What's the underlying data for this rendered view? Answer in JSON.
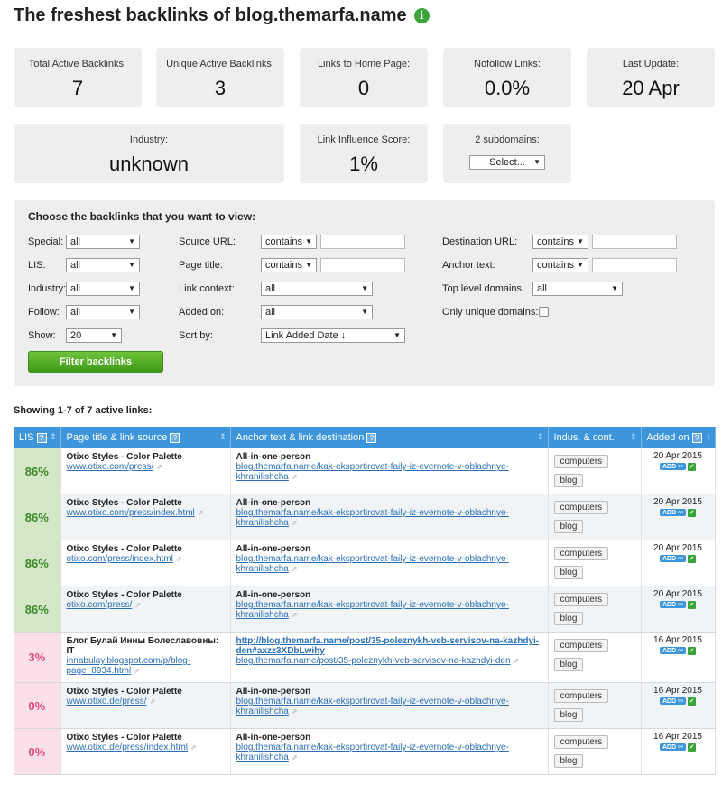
{
  "page_title": "The freshest backlinks of blog.themarfa.name",
  "stats": {
    "total_label": "Total Active Backlinks:",
    "total_value": "7",
    "unique_label": "Unique Active Backlinks:",
    "unique_value": "3",
    "home_label": "Links to Home Page:",
    "home_value": "0",
    "nofollow_label": "Nofollow Links:",
    "nofollow_value": "0.0%",
    "update_label": "Last Update:",
    "update_value": "20 Apr",
    "industry_label": "Industry:",
    "industry_value": "unknown",
    "lis_label": "Link Influence Score:",
    "lis_value": "1%",
    "subdomains_label": "2 subdomains:",
    "subdomains_select": "Select..."
  },
  "filter": {
    "heading": "Choose the backlinks that you want to view:",
    "special_label": "Special:",
    "special_value": "all",
    "lis_label": "LIS:",
    "lis_value": "all",
    "industry_label": "Industry:",
    "industry_value": "all",
    "follow_label": "Follow:",
    "follow_value": "all",
    "show_label": "Show:",
    "show_value": "20",
    "source_url_label": "Source URL:",
    "source_url_op": "contains",
    "page_title_label": "Page title:",
    "page_title_op": "contains",
    "link_context_label": "Link context:",
    "link_context_value": "all",
    "added_on_label": "Added on:",
    "added_on_value": "all",
    "sort_by_label": "Sort by:",
    "sort_by_value": "Link Added Date ↓",
    "dest_url_label": "Destination URL:",
    "dest_url_op": "contains",
    "anchor_text_label": "Anchor text:",
    "anchor_text_op": "contains",
    "tld_label": "Top level domains:",
    "tld_value": "all",
    "unique_domains_label": "Only unique domains:",
    "button": "Filter backlinks"
  },
  "showing": "Showing 1-7 of 7 active links:",
  "columns": [
    "LIS",
    "Page title & link source",
    "Anchor text & link destination",
    "Indus. & cont.",
    "Added on"
  ],
  "rows": [
    {
      "lis": "86%",
      "title": "Otixo Styles - Color Palette",
      "source": "www.otixo.com/press/",
      "anchor": "All-in-one-person",
      "dest": "blog.themarfa.name/kak-eksportirovat-faily-iz-evernote-v-oblachnye-khranilishcha",
      "industry": "computers",
      "context": "blog",
      "date": "20 Apr 2015"
    },
    {
      "lis": "86%",
      "title": "Otixo Styles - Color Palette",
      "source": "www.otixo.com/press/index.html",
      "anchor": "All-in-one-person",
      "dest": "blog.themarfa.name/kak-eksportirovat-faily-iz-evernote-v-oblachnye-khranilishcha",
      "industry": "computers",
      "context": "blog",
      "date": "20 Apr 2015"
    },
    {
      "lis": "86%",
      "title": "Otixo Styles - Color Palette",
      "source": "otixo.com/press/index.html",
      "anchor": "All-in-one-person",
      "dest": "blog.themarfa.name/kak-eksportirovat-faily-iz-evernote-v-oblachnye-khranilishcha",
      "industry": "computers",
      "context": "blog",
      "date": "20 Apr 2015"
    },
    {
      "lis": "86%",
      "title": "Otixo Styles - Color Palette",
      "source": "otixo.com/press/",
      "anchor": "All-in-one-person",
      "dest": "blog.themarfa.name/kak-eksportirovat-faily-iz-evernote-v-oblachnye-khranilishcha",
      "industry": "computers",
      "context": "blog",
      "date": "20 Apr 2015"
    },
    {
      "lis": "3%",
      "title": "Блог Булай Инны Болеславовны: IT",
      "source": "innabulay.blogspot.com/p/blog-page_8934.html",
      "anchor": "http://blog.themarfa.name/post/35-poleznykh-veb-servisov-na-kazhdyi-den#axzz3XDbLwihy",
      "dest": "blog.themarfa.name/post/35-poleznykh-veb-servisov-na-kazhdyi-den",
      "industry": "computers",
      "context": "blog",
      "date": "16 Apr 2015"
    },
    {
      "lis": "0%",
      "title": "Otixo Styles - Color Palette",
      "source": "www.otixo.de/press/",
      "anchor": "All-in-one-person",
      "dest": "blog.themarfa.name/kak-eksportirovat-faily-iz-evernote-v-oblachnye-khranilishcha",
      "industry": "computers",
      "context": "blog",
      "date": "16 Apr 2015"
    },
    {
      "lis": "0%",
      "title": "Otixo Styles - Color Palette",
      "source": "www.otixo.de/press/index.html",
      "anchor": "All-in-one-person",
      "dest": "blog.themarfa.name/kak-eksportirovat-faily-iz-evernote-v-oblachnye-khranilishcha",
      "industry": "computers",
      "context": "blog",
      "date": "16 Apr 2015"
    }
  ],
  "help_glyph": "?",
  "add_badge": "ADD ⚯",
  "ok_badge": "✔"
}
